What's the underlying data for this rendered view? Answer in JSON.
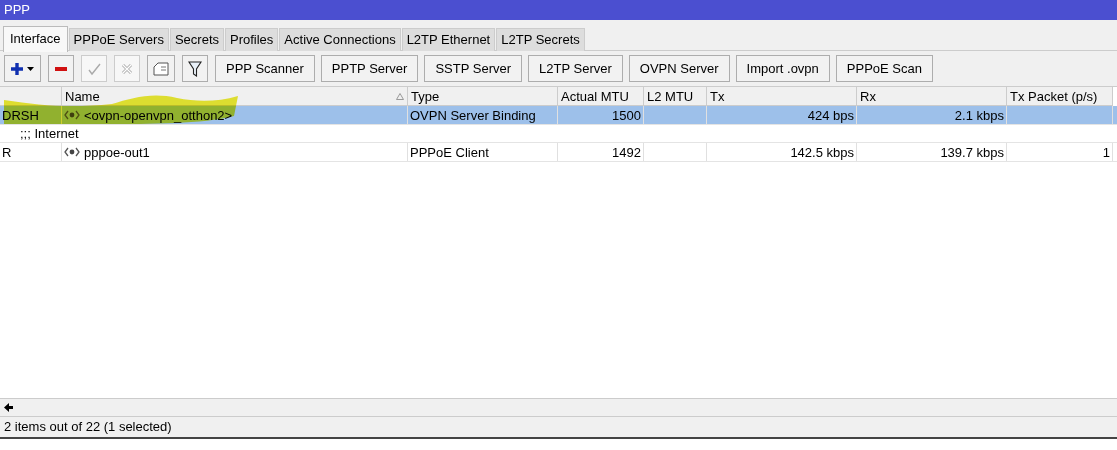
{
  "window": {
    "title": "PPP"
  },
  "tabs": [
    {
      "label": "Interface",
      "selected": true
    },
    {
      "label": "PPPoE Servers",
      "selected": false
    },
    {
      "label": "Secrets",
      "selected": false
    },
    {
      "label": "Profiles",
      "selected": false
    },
    {
      "label": "Active Connections",
      "selected": false
    },
    {
      "label": "L2TP Ethernet",
      "selected": false
    },
    {
      "label": "L2TP Secrets",
      "selected": false
    }
  ],
  "toolbar": {
    "icon_buttons": [
      {
        "kind": "add",
        "disabled": false
      },
      {
        "kind": "remove",
        "disabled": false
      },
      {
        "kind": "enable",
        "disabled": true
      },
      {
        "kind": "disable",
        "disabled": true
      },
      {
        "kind": "comment",
        "disabled": false
      },
      {
        "kind": "filter",
        "disabled": false
      }
    ],
    "buttons": [
      "PPP Scanner",
      "PPTP Server",
      "SSTP Server",
      "L2TP Server",
      "OVPN Server",
      "Import .ovpn",
      "PPPoE Scan"
    ]
  },
  "table": {
    "columns": [
      {
        "sorted": false
      },
      {
        "label": "Name",
        "sorted": true
      },
      {
        "label": "Type",
        "sorted": false
      },
      {
        "label": "Actual MTU",
        "sorted": false
      },
      {
        "label": "L2 MTU",
        "sorted": false
      },
      {
        "label": "Tx",
        "sorted": false
      },
      {
        "label": "Rx",
        "sorted": false
      },
      {
        "label": "Tx Packet (p/s)",
        "sorted": false
      }
    ],
    "rows": [
      {
        "kind": "row",
        "selected": true,
        "cells": [
          "DRSH",
          "<ovpn-openvpn_otthon2>",
          "OVPN Server Binding",
          "1500",
          "",
          "424 bps",
          "2.1 kbps",
          ""
        ]
      },
      {
        "kind": "comment",
        "selected": false,
        "text": ";;; Internet"
      },
      {
        "kind": "row",
        "selected": false,
        "cells": [
          "R",
          "pppoe-out1",
          "PPPoE Client",
          "1492",
          "",
          "142.5 kbps",
          "139.7 kbps",
          "1"
        ]
      }
    ]
  },
  "annotation": {
    "kind": "highlight"
  },
  "status_bar": "2 items out of 22 (1 selected)"
}
